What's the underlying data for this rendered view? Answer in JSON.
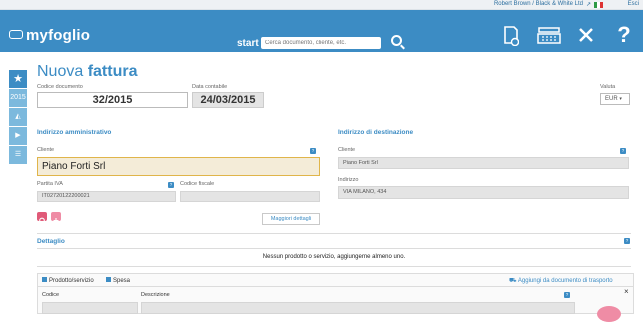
{
  "topbar": {
    "user": "Robert Brown / Black & White Ltd",
    "exit": "Esci"
  },
  "header": {
    "logo": "myfoglio",
    "search_label": "start",
    "search_placeholder": "Cerca documento, cliente, etc.",
    "icons": [
      "new-document-icon",
      "cash-register-icon",
      "tools-icon",
      "help-icon"
    ]
  },
  "sidebar": {
    "items": [
      "star",
      "2015",
      "stats",
      "play",
      "list"
    ]
  },
  "form": {
    "title_light": "Nuova",
    "title_bold": "fattura",
    "codice_label": "Codice documento",
    "codice_value": "32/2015",
    "data_label": "Data contabile",
    "data_value": "24/03/2015",
    "valuta_label": "Valuta",
    "valuta_value": "EUR"
  },
  "admin": {
    "title": "Indirizzo amministrativo",
    "cliente_label": "Cliente",
    "cliente_value": "Piano Forti Srl",
    "piva_label": "Partita IVA",
    "piva_value": "IT02720122200021",
    "cf_label": "Codice fiscale",
    "cf_value": "",
    "more_button": "Maggiori dettagli"
  },
  "dest": {
    "title": "Indirizzo di destinazione",
    "cliente_label": "Cliente",
    "cliente_value": "Piano Forti Srl",
    "indirizzo_label": "Indirizzo",
    "indirizzo_value": "VIA MILANO, 434"
  },
  "dettaglio": {
    "title": "Dettaglio",
    "empty_message": "Nessun prodotto o servizio, aggiungerne almeno uno.",
    "tab_product": "Prodotto/servizio",
    "tab_expense": "Spesa",
    "add_from_transport": "Aggiungi da documento di trasporto",
    "col_code": "Codice",
    "col_desc": "Descrizione",
    "close": "×"
  }
}
